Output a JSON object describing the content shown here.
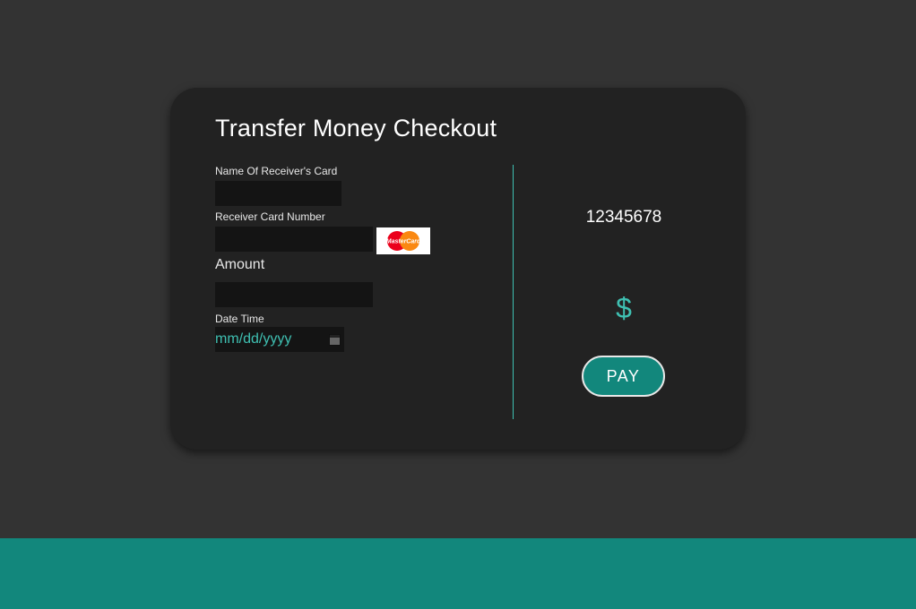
{
  "checkout": {
    "title": "Transfer Money Checkout",
    "fields": {
      "receiver_name": {
        "label": "Name Of Receiver's Card",
        "value": ""
      },
      "card_number": {
        "label": "Receiver Card Number",
        "value": ""
      },
      "amount": {
        "label": "Amount",
        "value": ""
      },
      "date_time": {
        "label": "Date Time",
        "placeholder": "mm/dd/yyyy"
      }
    },
    "card_brand": {
      "icon": "mastercard-logo",
      "text": "MasterCard"
    },
    "summary": {
      "card_number_display": "12345678",
      "currency_symbol": "$",
      "pay_label": "PAY"
    }
  },
  "colors": {
    "page_background": "#333333",
    "card_background": "#222222",
    "accent": "#12877c",
    "accent_text": "#3fc0b2",
    "field_background": "#141414"
  }
}
